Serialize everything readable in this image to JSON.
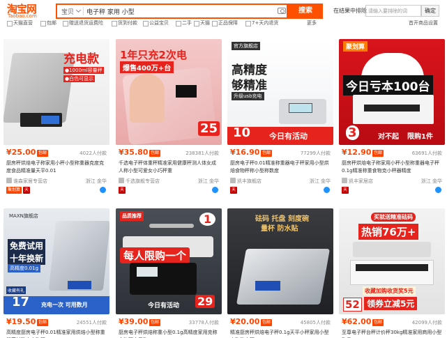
{
  "header": {
    "logo_cn": "淘宝网",
    "logo_en": "Taobao.com",
    "search_type": "宝贝",
    "search_query": "电子秤 家用 小型",
    "search_button": "搜索",
    "within_label": "在结果中排除",
    "within_placeholder": "请输入要排除的词",
    "within_button": "确定"
  },
  "filters": [
    "天猫直营",
    "包邮",
    "赠送退货运费险",
    "货到付款",
    "公益宝贝",
    "二手",
    "天猫",
    "正品保障",
    "7+天内退货"
  ],
  "filters_more": "更多",
  "filters_right": "首开商品设置",
  "products": [
    {
      "price": "¥25.00",
      "baoyou": "包邮",
      "sales": "4022人付款",
      "title": "厨房秤烘焙电子称家用小秤小型称重器克度克度食品精准量天平0.01",
      "shop": "谁森家居专营店",
      "location": "浙江 金华",
      "badges": [
        "聚划算",
        "天"
      ],
      "ov": [
        "充电款",
        "●1000ml容量秤",
        "●白色可显示"
      ]
    },
    {
      "price": "¥35.80",
      "baoyou": "包邮",
      "sales": "238381人付款",
      "title": "千选电子秤体重秤精准家用健康秤测人体女成人称小型可爱女小巧秤重",
      "shop": "千选旗舰专营店",
      "location": "浙江 金华",
      "badges": [
        "天"
      ],
      "ov": [
        "1年只充2次电",
        "爆售400万+台",
        "25"
      ]
    },
    {
      "price": "¥16.90",
      "baoyou": "包邮",
      "sales": "77299人付款",
      "title": "厨房电子秤0.01精准称重器电子秤家用小型烘焙食物秤称小型称数度",
      "shop": "凯丰旗舰店",
      "location": "浙江 金华",
      "badges": [
        "天"
      ],
      "ov": [
        "官方旗舰店",
        "高精度",
        "够精准",
        "升级usb充电",
        "10",
        "今日有活动"
      ]
    },
    {
      "price": "¥12.90",
      "baoyou": "包邮",
      "sales": "63691人付款",
      "title": "厨房秤烘焙电子称家用小秤小型称重器电子秤0.1g精准称重食物克小秤器精度",
      "shop": "凯丰家居店",
      "location": "浙江 金华",
      "badges": [
        "天"
      ],
      "ov": [
        "聚划算",
        "今日亏本100台",
        "3",
        "对不起",
        "限购1件"
      ]
    },
    {
      "price": "¥19.50",
      "baoyou": "包邮",
      "sales": "24551人付款",
      "title": "高精度厨房电子秤0.01精准家用烘焙小型称重器药材珠宝克称秤",
      "shop": "",
      "location": "",
      "badges": [],
      "ov": [
        "MAXN旗舰店",
        "免费试用",
        "十年换新",
        "高精度0.01g",
        "收藏有礼",
        "17",
        "充电一次 可用数月"
      ]
    },
    {
      "price": "¥39.00",
      "baoyou": "包邮",
      "sales": "33778人付款",
      "title": "厨房电子秤烘焙称重小型0.1g高精度家用克称食物秤电子称",
      "shop": "",
      "location": "",
      "badges": [],
      "ov": [
        "品质推荐",
        "1",
        "每人限购一个",
        "今日有活动",
        "29"
      ]
    },
    {
      "price": "¥20.00",
      "baoyou": "包邮",
      "sales": "45805人付款",
      "title": "精准厨房秤烘焙电子秤0.1g天平小秤家用小型克称数克秤",
      "shop": "",
      "location": "",
      "badges": [],
      "ov": [
        "砝码 托盘 刻度碗",
        "量杯 防水贴"
      ]
    },
    {
      "price": "¥62.00",
      "baoyou": "包邮",
      "sales": "42099人付款",
      "title": "至尊电子秤台秤计价秤30kg精准家用商用小型称重",
      "shop": "",
      "location": "",
      "badges": [],
      "ov": [
        "买就送精准砝码",
        "热销76万+",
        "收藏加购收货奖5元",
        "领券立减5元",
        "52"
      ]
    }
  ]
}
